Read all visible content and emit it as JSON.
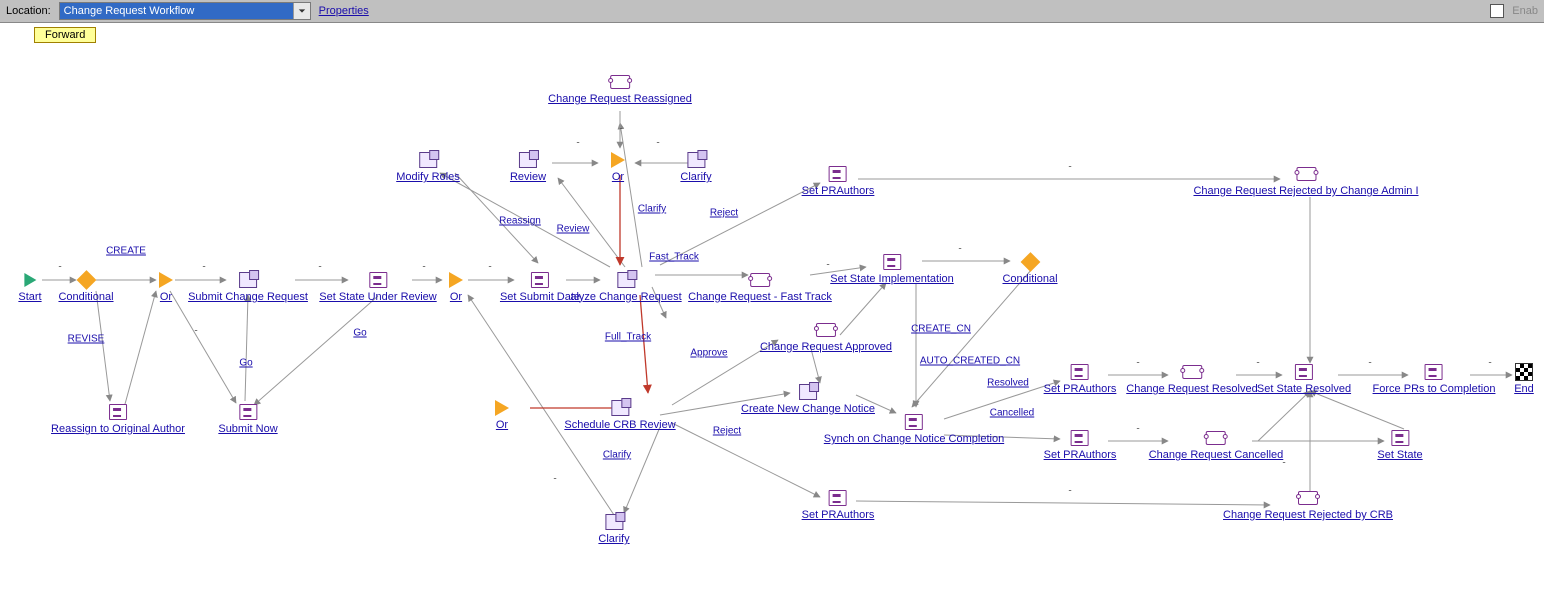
{
  "toolbar": {
    "location_label": "Location:",
    "dropdown_value": "Change Request Workflow",
    "properties": "Properties",
    "enable_label": "Enab",
    "forward": "Forward"
  },
  "nodes": {
    "start": "Start",
    "conditional1": "Conditional",
    "or1": "Or",
    "submit_cr": "Submit Change Request",
    "set_state_under_review": "Set State Under Review",
    "or2": "Or",
    "set_submit_date": "Set Submit Date",
    "analyze_cr": "alyze Change Request",
    "cr_fast_track": "Change Request - Fast Track",
    "set_state_impl": "Set State Implementation",
    "conditional2": "Conditional",
    "reassign_orig": "Reassign to Original Author",
    "submit_now": "Submit Now",
    "modify_roles": "Modify Roles",
    "review": "Review",
    "or_top": "Or",
    "clarify_top": "Clarify",
    "cr_reassigned": "Change Request Reassigned",
    "set_pr_authors1": "Set PRAuthors",
    "cr_rejected_admin": "Change Request Rejected by Change Admin I",
    "or3": "Or",
    "schedule_crb": "Schedule CRB Review",
    "cr_approved": "Change Request Approved",
    "create_new_cn": "Create New Change Notice",
    "synch_cn": "Synch on Change Notice Completion",
    "set_pr_authors2": "Set PRAuthors",
    "cr_resolved": "Change Request Resolved",
    "set_state_resolved": "Set State Resolved",
    "force_prs": "Force PRs to Completion",
    "end": "End",
    "set_pr_authors3": "Set PRAuthors",
    "cr_cancelled": "Change Request Cancelled",
    "set_state2": "Set State",
    "set_pr_authors4": "Set PRAuthors",
    "cr_rejected_crb": "Change Request Rejected by CRB",
    "clarify2": "Clarify"
  },
  "edges": {
    "create": "CREATE",
    "revise": "REVISE",
    "go": "Go",
    "reassign": "Reassign",
    "review": "Review",
    "clarify": "Clarify",
    "reject": "Reject",
    "fast_track": "Fast_Track",
    "full_track": "Full_Track",
    "approve": "Approve",
    "create_cn": "CREATE_CN",
    "auto_created_cn": "AUTO_CREATED_CN",
    "resolved": "Resolved",
    "cancelled": "Cancelled",
    "dash": "-"
  }
}
